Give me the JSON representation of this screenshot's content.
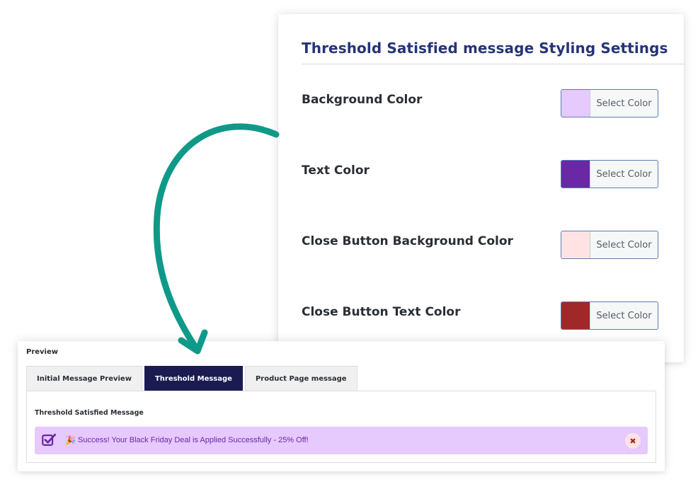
{
  "settings": {
    "title": "Threshold Satisfied message Styling Settings",
    "rows": [
      {
        "label": "Background Color",
        "button_label": "Select Color",
        "color": "#e6c9fd"
      },
      {
        "label": "Text Color",
        "button_label": "Select Color",
        "color": "#6a27a6"
      },
      {
        "label": "Close Button Background Color",
        "button_label": "Select Color",
        "color": "#ffe3e3"
      },
      {
        "label": "Close Button Text Color",
        "button_label": "Select Color",
        "color": "#a02828"
      }
    ]
  },
  "arrow": {
    "color": "#0f9988"
  },
  "preview": {
    "heading": "Preview",
    "tabs": [
      {
        "label": "Initial Message Preview",
        "active": false
      },
      {
        "label": "Threshold Message",
        "active": true
      },
      {
        "label": "Product Page message",
        "active": false
      }
    ],
    "content_heading": "Threshold Satisfied Message",
    "message": {
      "icon": "check-square-icon",
      "emoji": "🎉",
      "text": "Success! Your Black Friday Deal is Applied Successfully - 25% Off!",
      "close_symbol": "✖",
      "background": "#e6c9fd",
      "text_color": "#6a27a6",
      "close_bg": "#ffe3e3",
      "close_color": "#a02828"
    }
  }
}
